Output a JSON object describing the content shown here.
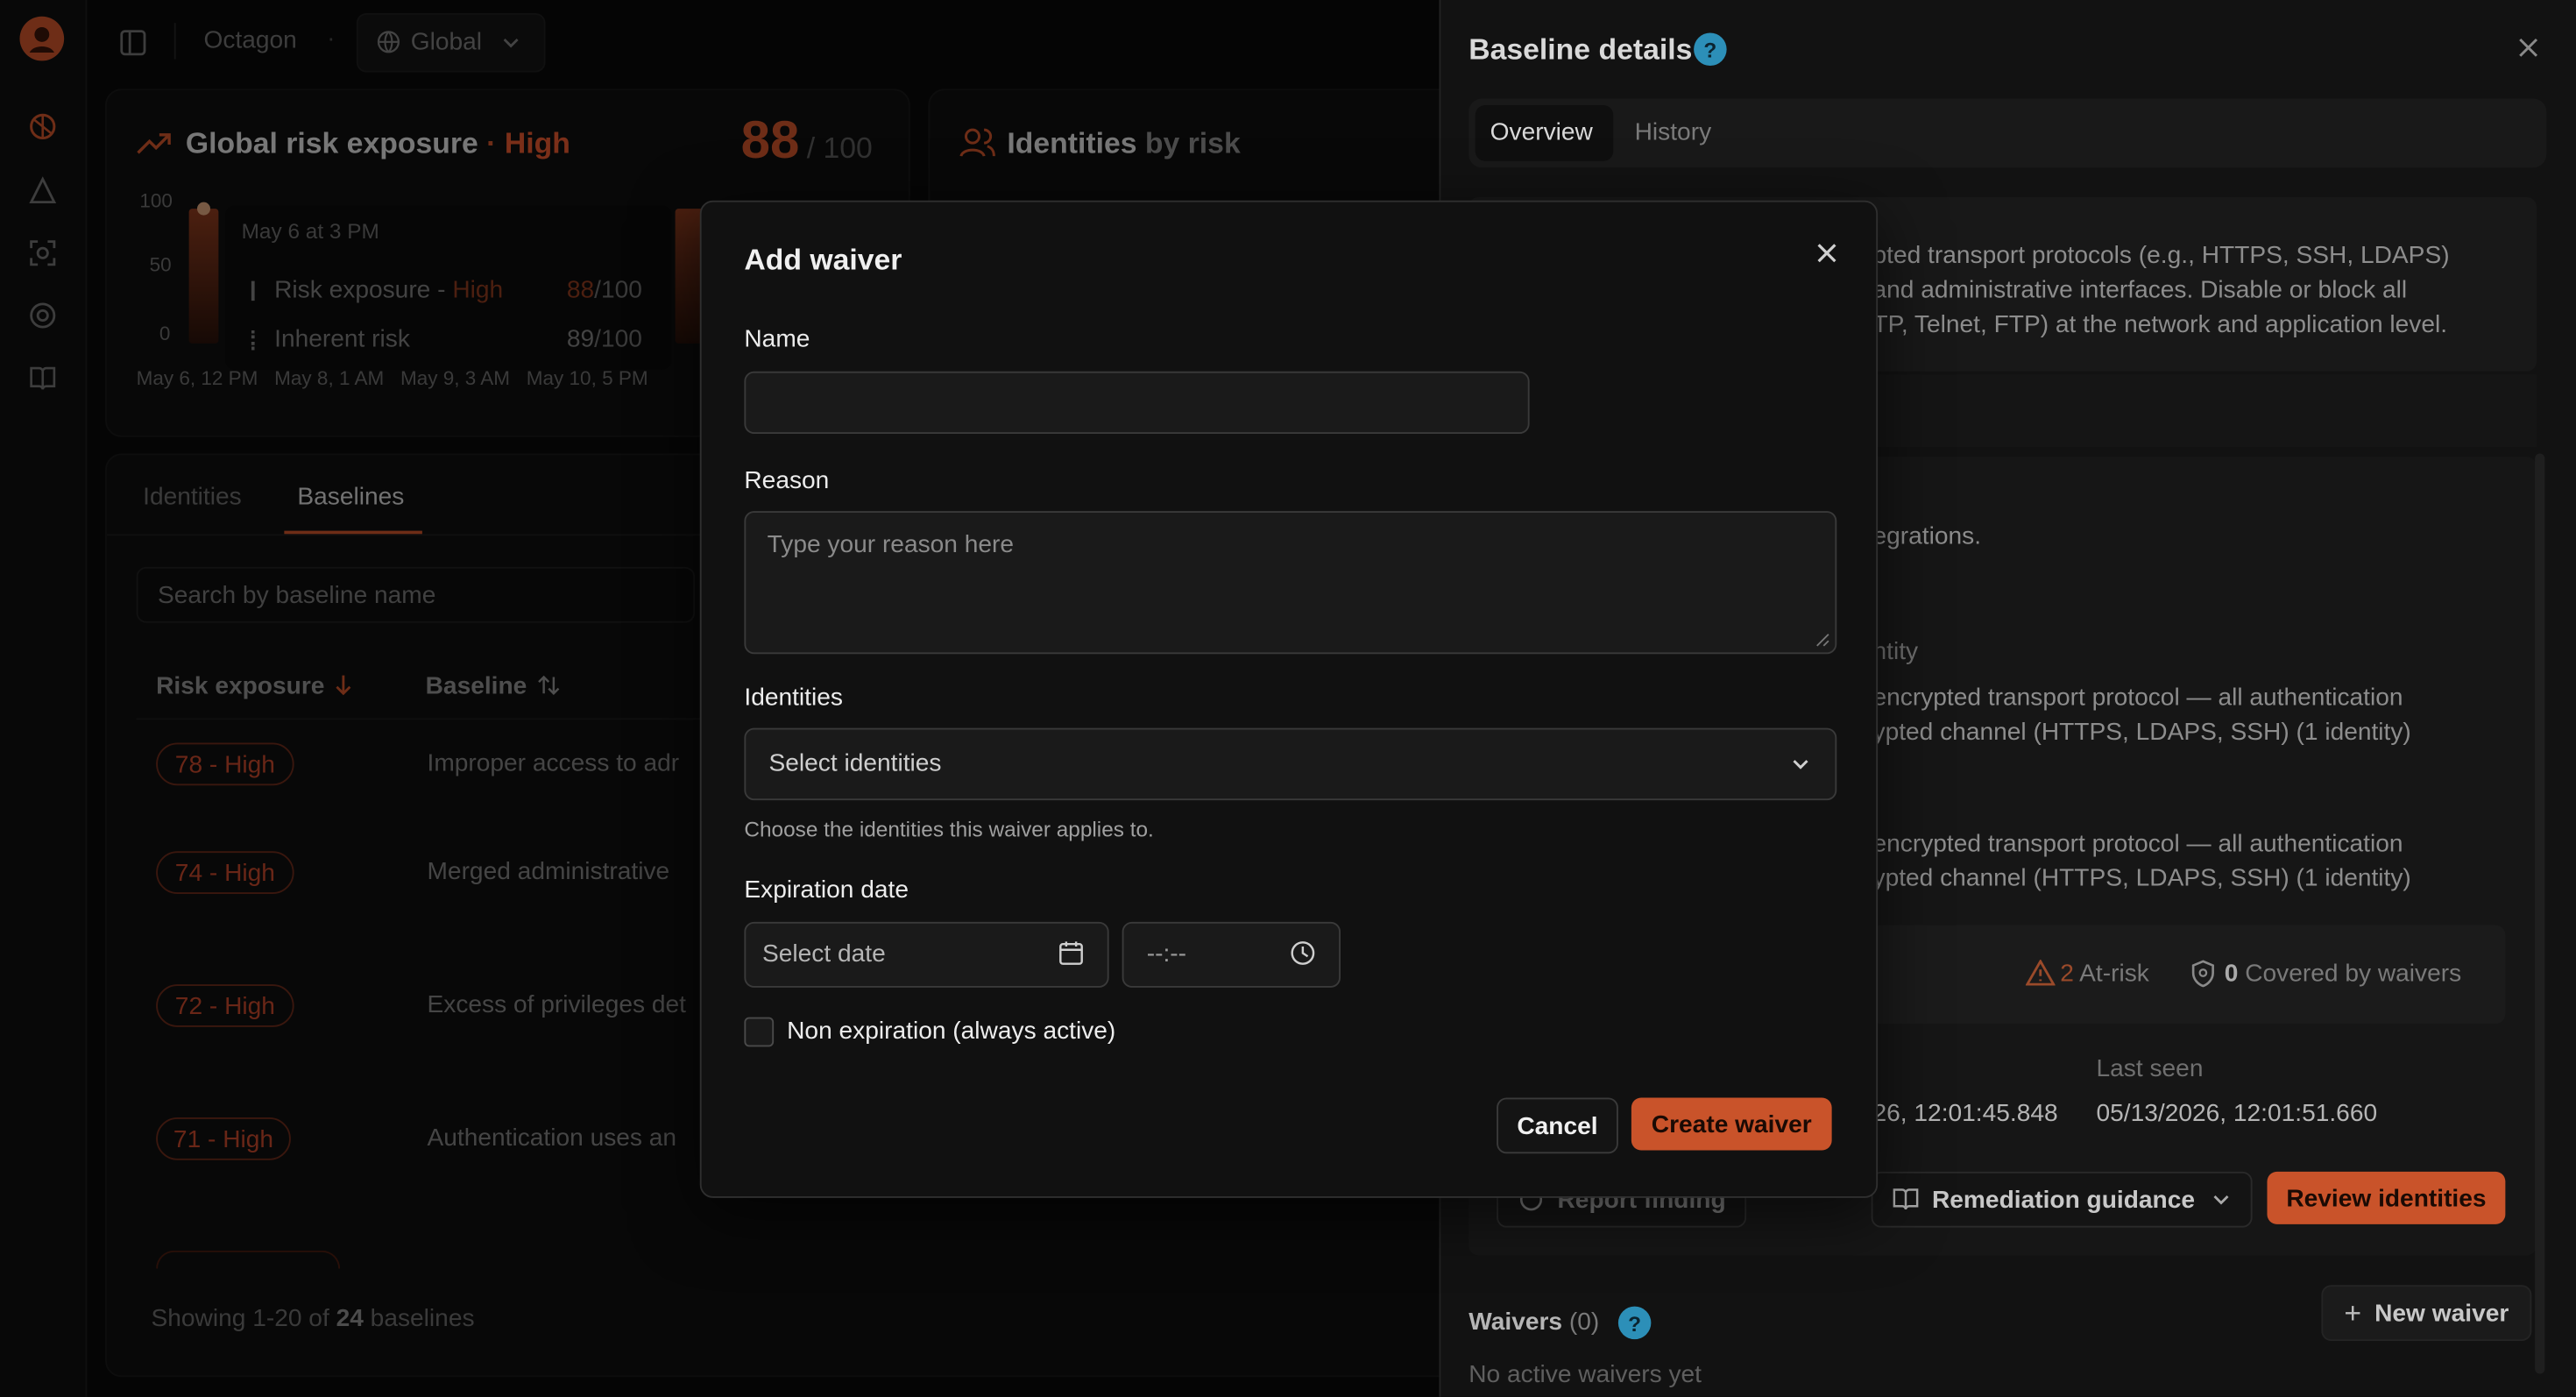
{
  "topbar": {
    "org": "Octagon",
    "scope": "Global"
  },
  "risk_card": {
    "title": "Global risk exposure",
    "separator": "·",
    "level": "High",
    "score": "88",
    "max": "/ 100",
    "y_ticks": [
      "100",
      "50",
      "0"
    ],
    "x_ticks": "May 6, 12 PM   May 8, 1 AM   May 9, 3 AM   May 10, 5 PM",
    "tooltip": {
      "date": "May 6 at 3 PM",
      "row1_label": "Risk exposure",
      "row1_sep": " - ",
      "row1_level": "High",
      "row1_value": "88",
      "row1_max": "/100",
      "row2_label": "Inherent risk",
      "row2_value": "89",
      "row2_max": "/100"
    }
  },
  "identities_card": {
    "title_bold": "Identities",
    "title_rest": " by risk"
  },
  "tabs": {
    "identities": "Identities",
    "baselines": "Baselines"
  },
  "search": {
    "placeholder": "Search by baseline name"
  },
  "table": {
    "col_risk": "Risk exposure",
    "col_baseline": "Baseline",
    "rows": [
      {
        "badge": "78 - High",
        "text": "Improper access to adr"
      },
      {
        "badge": "74 - High",
        "text": "Merged administrative"
      },
      {
        "badge": "72 - High",
        "text": "Excess of privileges det"
      },
      {
        "badge": "71 - High",
        "text": "Authentication uses an"
      }
    ],
    "footer_prefix": "Showing 1-20 of ",
    "footer_count": "24",
    "footer_suffix": " baselines"
  },
  "panel": {
    "title": "Baseline details",
    "tab_overview": "Overview",
    "tab_history": "History",
    "desc_lines": [
      "pted transport protocols (e.g., HTTPS, SSH, LDAPS)",
      "and administrative interfaces. Disable or block all",
      "TP, Telnet, FTP) at the network and application level."
    ],
    "integrations": "egrations.",
    "identity_hdr": "ntity",
    "finding1_l1": "encrypted transport protocol — all authentication",
    "finding1_l2": "ypted channel (HTTPS, LDAPS, SSH) (1 identity)",
    "finding2_l1": "encrypted transport protocol — all authentication",
    "finding2_l2": "ypted channel (HTTPS, LDAPS, SSH) (1 identity)",
    "at_risk_count": "2",
    "at_risk_label": "At-risk",
    "covered_count": "0",
    "covered_label": "Covered by waivers",
    "first_seen_value": "26, 12:01:45.848",
    "last_seen_label": "Last seen",
    "last_seen_value": "05/13/2026, 12:01:51.660",
    "report_finding": "Report finding",
    "remediation": "Remediation guidance",
    "review_identities": "Review identities",
    "waivers_label": "Waivers",
    "waivers_count": "(0)",
    "new_waiver": "New waiver",
    "no_waivers": "No active waivers yet"
  },
  "modal": {
    "title": "Add waiver",
    "name_label": "Name",
    "name_value": "",
    "reason_label": "Reason",
    "reason_placeholder": "Type your reason here",
    "identities_label": "Identities",
    "identities_placeholder": "Select identities",
    "identities_help": "Choose the identities this waiver applies to.",
    "expiration_label": "Expiration date",
    "date_placeholder": "Select date",
    "time_placeholder": "--:--",
    "non_expiration_label": "Non expiration (always active)",
    "cancel": "Cancel",
    "create": "Create waiver"
  },
  "colors": {
    "accent": "#c9532a",
    "accent_text": "#e0572e",
    "help_blue": "#2c8fb8"
  }
}
